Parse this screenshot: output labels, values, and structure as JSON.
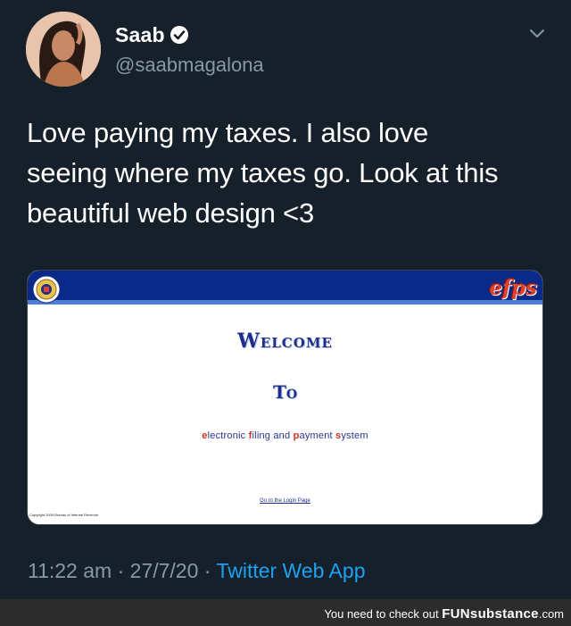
{
  "tweet": {
    "display_name": "Saab",
    "handle": "@saabmagalona",
    "text_lines": [
      "Love paying my taxes. I also love",
      "seeing where my taxes go. Look at this",
      "beautiful web design <3"
    ],
    "time": "11:22 am",
    "separator1": " · ",
    "date": "27/7/20",
    "separator2": " · ",
    "source": "Twitter Web App"
  },
  "embedded_page": {
    "logo": "efps",
    "welcome": "Welcome",
    "to": "To",
    "system_name_parts": [
      "e",
      "lectronic ",
      "f",
      "iling and ",
      "p",
      "ayment ",
      "s",
      "ystem"
    ],
    "login_link": "Go to the Login Page",
    "copyright": "Copyright 2009 Bureau of Internal Revenue"
  },
  "watermark": {
    "prefix": "You need to check out ",
    "brand": "FUNsubstance",
    "suffix": ".com"
  },
  "colors": {
    "background": "#15202b",
    "text": "#ffffff",
    "secondary": "#8899a6",
    "link": "#1da1f2",
    "efps_header": "#0a2a8a",
    "efps_accent": "#e0402f"
  },
  "icons": [
    "verified-badge-icon",
    "chevron-down-icon",
    "seal-icon"
  ]
}
